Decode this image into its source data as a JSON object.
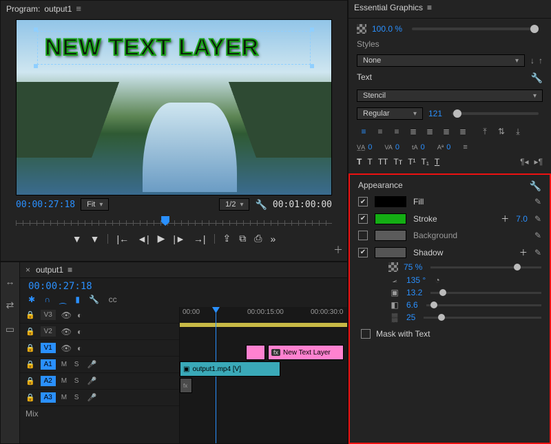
{
  "program": {
    "title_prefix": "Program:",
    "title": "output1",
    "preview_text": "NEW TEXT LAYER",
    "current_tc": "00:00:27:18",
    "fit_label": "Fit",
    "zoom_label": "1/2",
    "duration_tc": "00:01:00:00"
  },
  "timeline": {
    "tab": "output1",
    "current_tc": "00:00:27:18",
    "ruler": {
      "t0": "00:00",
      "t1": "00:00:15:00",
      "t2": "00:00:30:0"
    },
    "tracks": {
      "v3": "V3",
      "v2": "V2",
      "v1": "V1",
      "a1": "A1",
      "a2": "A2",
      "a3": "A3",
      "mix": "Mix"
    },
    "clip_text_layer": "New Text Layer",
    "clip_video": "output1.mp4 [V]",
    "fx": "fx",
    "ms": "M   S"
  },
  "eg": {
    "panel_title": "Essential Graphics",
    "opacity_value": "100.0 %",
    "styles_label": "Styles",
    "styles_value": "None",
    "text_label": "Text",
    "font_family": "Stencil",
    "font_style": "Regular",
    "font_size": "121",
    "kern": "0",
    "track": "0",
    "leading": "0",
    "baseline": "0",
    "va_label": "VA",
    "tsume": "A"
  },
  "appearance": {
    "title": "Appearance",
    "fill_label": "Fill",
    "stroke_label": "Stroke",
    "stroke_value": "7.0",
    "background_label": "Background",
    "shadow_label": "Shadow",
    "shadow_opacity": "75 %",
    "shadow_angle": "135 °",
    "shadow_distance": "13.2",
    "shadow_size": "6.6",
    "shadow_blur": "25",
    "mask_label": "Mask with Text"
  }
}
